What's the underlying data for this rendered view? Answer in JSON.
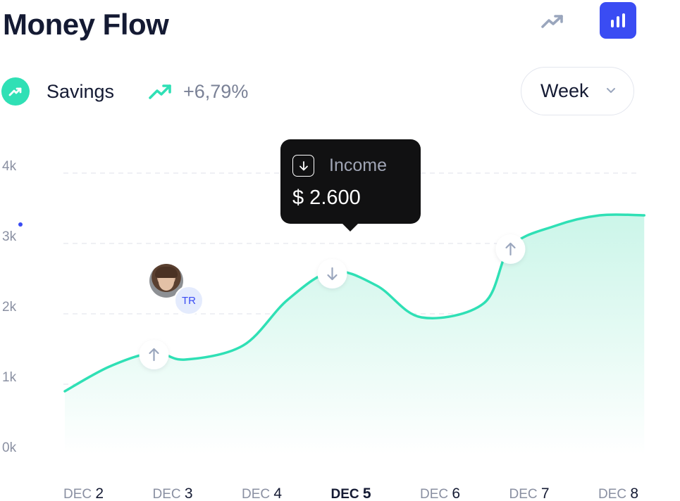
{
  "header": {
    "title": "Money Flow"
  },
  "toolbar": {
    "trend_icon": "trending-up-icon",
    "bar_icon": "bar-chart-icon",
    "active": "bar-chart"
  },
  "summary": {
    "label": "Savings",
    "change": "+6,79%"
  },
  "period": {
    "selected": "Week"
  },
  "tooltip": {
    "label": "Income",
    "value": "$ 2.600"
  },
  "user": {
    "initials": "TR"
  },
  "colors": {
    "accent": "#3a4cf3",
    "line": "#2fe0b5",
    "fill_top": "#c9f5e8",
    "tooltip_bg": "#111112",
    "text": "#141a33",
    "muted": "#7a8196"
  },
  "chart_data": {
    "type": "area",
    "categories": [
      "DEC 2",
      "DEC 3",
      "DEC 4",
      "DEC 5",
      "DEC 6",
      "DEC 7",
      "DEC 8"
    ],
    "active_category": "DEC 5",
    "x_ticks": [
      {
        "pre": "DEC ",
        "num": "2"
      },
      {
        "pre": "DEC ",
        "num": "3"
      },
      {
        "pre": "DEC ",
        "num": "4"
      },
      {
        "pre": "DEC ",
        "num": "5"
      },
      {
        "pre": "DEC ",
        "num": "6"
      },
      {
        "pre": "DEC ",
        "num": "7"
      },
      {
        "pre": "DEC ",
        "num": "8"
      }
    ],
    "yticks": [
      "0k",
      "1k",
      "2k",
      "3k",
      "4k"
    ],
    "ylim": [
      0,
      4000
    ],
    "grid": true,
    "series": [
      {
        "x": [
          2,
          2.5,
          3,
          3.35,
          4,
          4.5,
          5,
          5.5,
          6,
          6.7,
          7,
          7.5,
          8,
          8.5
        ],
        "values": [
          900,
          1250,
          1450,
          1350,
          1550,
          2200,
          2600,
          2400,
          1950,
          2150,
          2950,
          3250,
          3400,
          3400
        ]
      }
    ],
    "markers": [
      {
        "x": 3,
        "value": 1450,
        "icon": "arrow-up-icon"
      },
      {
        "x": 5,
        "value": 2600,
        "icon": "arrow-down-icon"
      },
      {
        "x": 7,
        "value": 2950,
        "icon": "arrow-up-icon"
      }
    ]
  }
}
